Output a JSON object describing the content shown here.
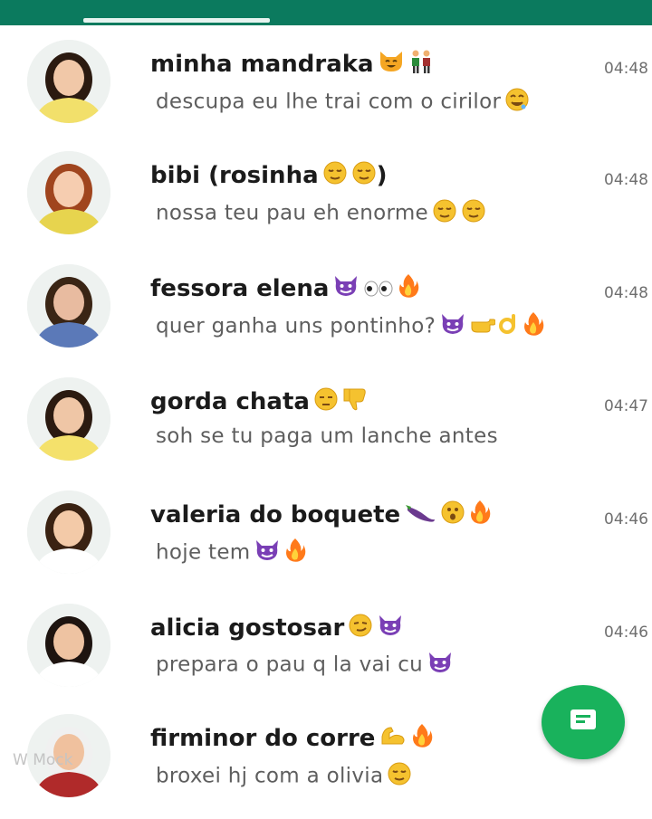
{
  "chats": [
    {
      "name": "minha mandraka",
      "message": "descupa eu lhe trai com o cirilor",
      "time": "04:48",
      "name_emojis": [
        "cat-icon",
        "couple-icon"
      ],
      "message_emojis": [
        "drool-face-icon"
      ]
    },
    {
      "name": "bibi (rosinha",
      "name_after": ")",
      "message": "nossa teu pau eh enorme",
      "time": "04:48",
      "name_emojis": [
        "sleepy-face-icon",
        "sleepy-face-icon"
      ],
      "message_emojis": [
        "sleepy-face-icon",
        "sleepy-face-icon"
      ]
    },
    {
      "name": "fessora elena",
      "message": "quer ganha uns pontinho?",
      "time": "04:48",
      "name_emojis": [
        "devil-icon",
        "eyes-icon",
        "fire-icon"
      ],
      "message_emojis": [
        "devil-icon",
        "point-right-icon",
        "ok-hand-icon",
        "fire-icon"
      ]
    },
    {
      "name": "gorda chata",
      "message": "soh se tu paga um lanche antes",
      "time": "04:47",
      "name_emojis": [
        "tired-face-icon",
        "thumbs-down-icon"
      ],
      "message_emojis": []
    },
    {
      "name": "valeria do boquete",
      "message": "hoje tem",
      "time": "04:46",
      "name_emojis": [
        "eggplant-icon",
        "surprised-face-icon",
        "fire-icon"
      ],
      "message_emojis": [
        "devil-icon",
        "fire-icon"
      ]
    },
    {
      "name": "alicia gostosar",
      "message": "prepara o pau q la vai cu",
      "time": "04:46",
      "name_emojis": [
        "smirk-face-icon",
        "devil-icon"
      ],
      "message_emojis": [
        "devil-icon"
      ]
    },
    {
      "name": "firminor do corre",
      "message": "broxei hj com a olivia",
      "time": "",
      "name_emojis": [
        "muscle-icon",
        "fire-icon"
      ],
      "message_emojis": [
        "sleepy-face-icon"
      ]
    }
  ],
  "colors": {
    "header": "#0b7a5e",
    "fab": "#19b25c",
    "devil": "#7a3fb5",
    "fire": "#ff7a1a",
    "face": "#f5c22f"
  },
  "watermark": "W       Mock"
}
